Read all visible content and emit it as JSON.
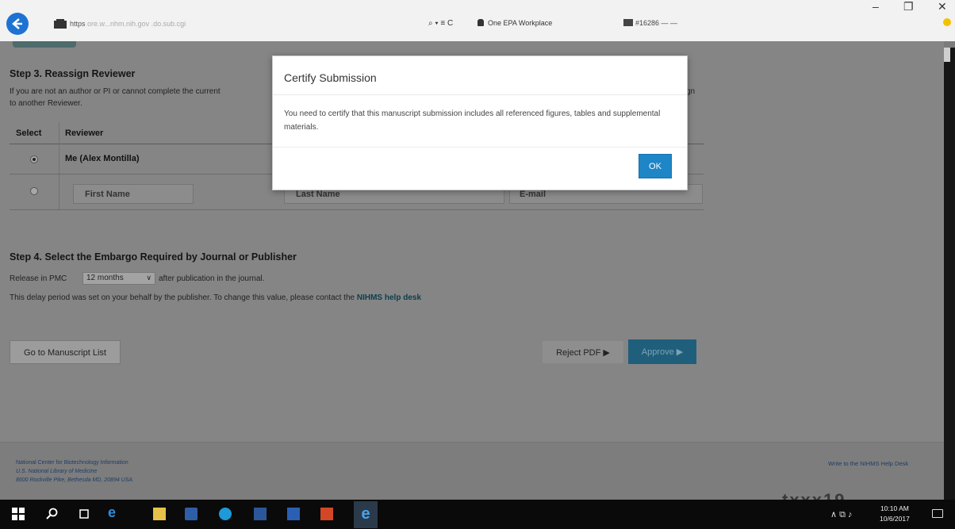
{
  "browser": {
    "url_prefix": "https",
    "url_faded": "ore.w...nhm.nih.gov .do.sub.cgi",
    "address_tools": "⌕ ▾ ≡ C",
    "tab_label": "One EPA Workplace",
    "tab2_label": "#16286 — —"
  },
  "step3": {
    "heading": "Step 3. Reassign Reviewer",
    "intro_line1": "If you are not an author or PI or cannot complete the current",
    "intro_line1_end": "gn",
    "intro_line2": "to another Reviewer.",
    "col_select": "Select",
    "col_reviewer": "Reviewer",
    "me_row": "Me (Alex Montilla)",
    "first_name_placeholder": "First Name",
    "last_name_placeholder": "Last Name",
    "email_placeholder": "E-mail"
  },
  "step4": {
    "heading": "Step 4. Select the Embargo Required by Journal or Publisher",
    "release_prefix": "Release in PMC",
    "embargo_value": "12 months",
    "release_suffix": "after publication in the journal.",
    "delay_note": "This delay period was set on your behalf by the publisher. To change this value, please contact the",
    "help_link": "NIHMS help desk"
  },
  "actions": {
    "go_to_list": "Go to Manuscript List",
    "reject": "Reject PDF ▶",
    "approve": "Approve ▶"
  },
  "footer": {
    "line1": "National Center for Biotechnology Information",
    "line2": "U.S. National Library of Medicine",
    "line3": "8600 Rockville Pike, Bethesda MD, 20894 USA",
    "write_link": "Write to the NIHMS Help Desk",
    "logo_text": "txxx19"
  },
  "modal": {
    "title": "Certify Submission",
    "message": "You need to certify that this manuscript submission includes all referenced figures, tables and supplemental materials.",
    "ok_label": "OK"
  },
  "taskbar": {
    "time": "10:10 AM",
    "date": "10/6/2017",
    "tray_icons": "∧ ⧉ ♪"
  },
  "colors": {
    "overlay_page": "#858585",
    "primary_button": "#1e86c7",
    "help_link": "#0d3d4d"
  }
}
